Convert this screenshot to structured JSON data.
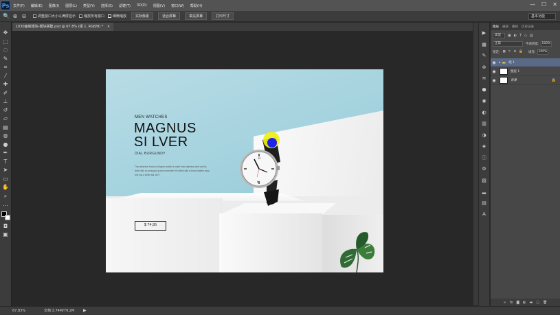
{
  "app": {
    "logo": "Ps",
    "menu": [
      "文件(F)",
      "编辑(E)",
      "图像(I)",
      "图层(L)",
      "类型(Y)",
      "选择(S)",
      "滤镜(T)",
      "3D(D)",
      "视图(V)",
      "窗口(W)",
      "帮助(H)"
    ],
    "window_controls": [
      "—",
      "☐",
      "✕"
    ]
  },
  "options_bar": {
    "tool_icon": "zoom-icon",
    "checkbox_resize": "调整窗口大小以满屏显示",
    "checkbox_zoom_all": "缩放所有窗口",
    "checkbox_scrubby": "细微缩放",
    "btn_actual": "实际像素",
    "btn_fit": "适合屏幕",
    "btn_fill": "填充屏幕",
    "btn_print": "打印尺寸",
    "workspace": "基本功能"
  },
  "document": {
    "tab_title": "1030面板模块-模块搭建.psd @ 67.8% (组 1, RGB/8) *",
    "close": "×"
  },
  "design": {
    "subtitle": "MEN WATCHES",
    "title_line1": "MAGNUS",
    "title_line2": "SI LVER",
    "dial": "DIAL BURGUNDY",
    "description": "This attractive Komono Magnus watch is made from stainless steel and its finish with an analogue quartz movement It is fitted with a brown leather strap and has a white dial. BUY",
    "price": "$ 74,95"
  },
  "status": {
    "zoom": "67.83%",
    "doc_size": "文档:3.74M/79.2M",
    "arrow": "▶"
  },
  "layers_panel": {
    "tabs": [
      "图层",
      "通道",
      "路径",
      "历史记录"
    ],
    "filter_label": "类型",
    "blend_mode": "正常",
    "opacity_label": "不透明度:",
    "opacity_value": "100%",
    "lock_label": "锁定:",
    "fill_label": "填充:",
    "fill_value": "100%",
    "layers": [
      {
        "name": "组 1",
        "type": "group",
        "selected": true
      },
      {
        "name": "图层 1",
        "type": "layer",
        "selected": false
      },
      {
        "name": "背景",
        "type": "background",
        "selected": false
      }
    ],
    "footer_icons": [
      "link-icon",
      "fx-icon",
      "mask-icon",
      "adjustment-icon",
      "folder-icon",
      "new-layer-icon",
      "trash-icon"
    ]
  },
  "colors": {
    "selection": "#5a6a86",
    "cursor_halo": "#eef014",
    "cursor_dot": "#1d22e8",
    "background_sky": "#9fd0dc"
  }
}
